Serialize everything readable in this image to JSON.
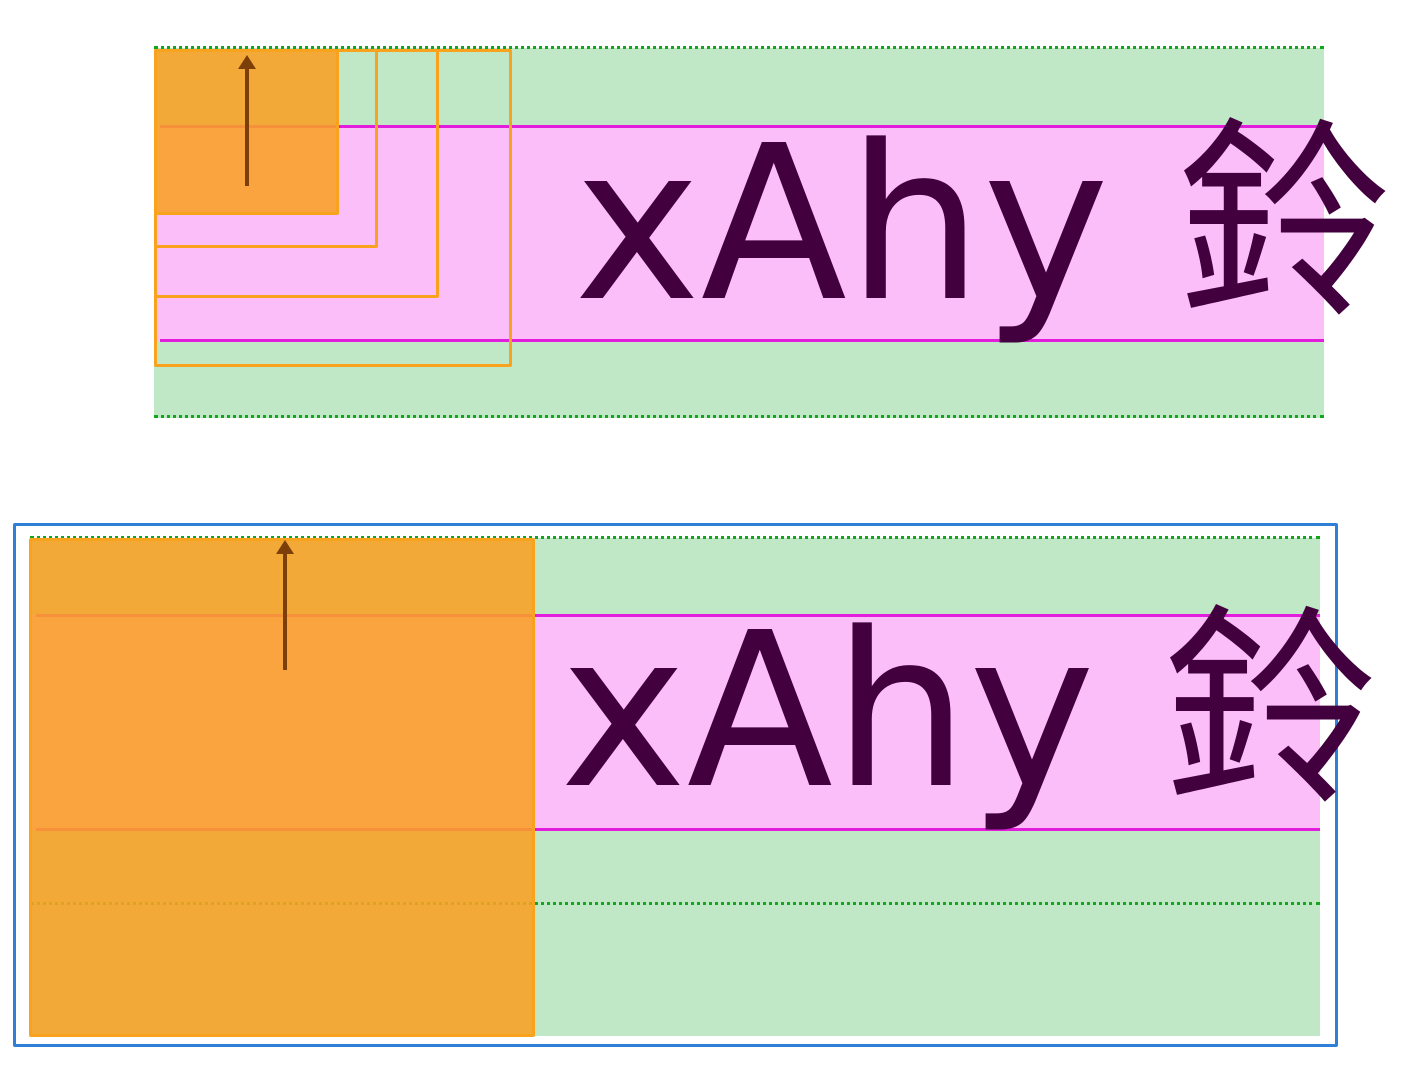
{
  "sample_text": "xAhy 鈴",
  "colors": {
    "line_box_fill": "#c0e7c6",
    "line_box_dotted_border": "#13a51c",
    "content_area_fill": "#fbbef8",
    "content_area_edge": "#e21ddb",
    "inline_box_orange": "#f8a21d",
    "inline_box_fill": "#f9a124",
    "arrow": "#7d3f0a",
    "text": "#42003e",
    "frame": "#2f7fd7"
  },
  "top_diagram": {
    "nested_outline_boxes_count": 3,
    "filled_box": true,
    "arrow_direction": "up"
  },
  "bottom_diagram": {
    "framed": true,
    "filled_box": true,
    "arrow_direction": "up"
  }
}
